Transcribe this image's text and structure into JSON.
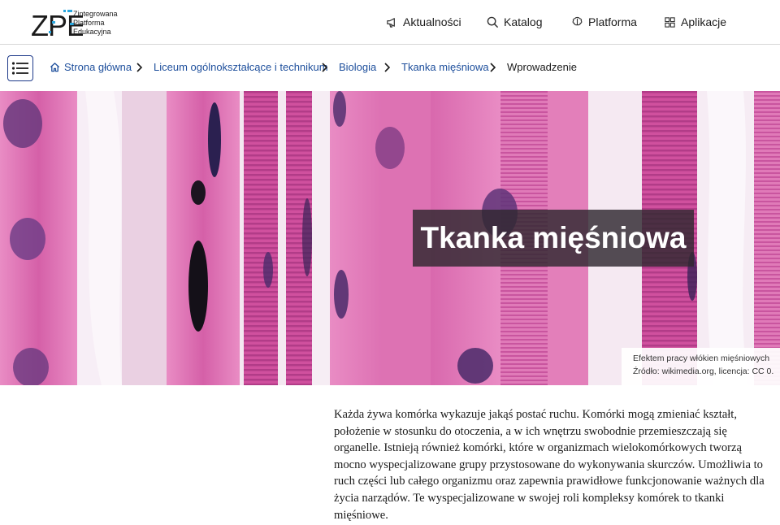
{
  "logo": {
    "mark": "ZPE",
    "line1": "Zintegrowana",
    "line2": "Platforma",
    "line3": "Edukacyjna"
  },
  "nav": [
    {
      "label": "Aktualności",
      "icon": "megaphone-icon"
    },
    {
      "label": "Katalog",
      "icon": "search-icon"
    },
    {
      "label": "Platforma",
      "icon": "brain-icon"
    },
    {
      "label": "Aplikacje",
      "icon": "grid-icon"
    }
  ],
  "breadcrumb": {
    "home": "Strona główna",
    "level1": "Liceum ogólnokształcące i technikum",
    "level2": "Biologia",
    "level3": "Tkanka mięśniowa",
    "current": "Wprowadzenie"
  },
  "hero": {
    "title": "Tkanka mięśniowa",
    "caption_line1": "Efektem pracy włókien mięśniowych",
    "caption_line2": "Źródło: wikimedia.org, licencja: CC 0."
  },
  "content": {
    "paragraph": "Każda żywa komórka wykazuje jakąś postać ruchu. Komórki mogą zmieniać kształt, położenie w stosunku do otoczenia, a w ich wnętrzu swobodnie przemieszczają się organelle. Istnieją również komórki, które w organizmach wielokomórkowych tworzą mocno wyspecjalizowane grupy przystosowane do wykonywania skurczów. Umożliwia to ruch części lub całego organizmu oraz zapewnia prawidłowe funkcjonowanie ważnych dla życia narządów. Te wyspecjalizowane w swojej roli kompleksy komórek to tkanki mięśniowe."
  },
  "colors": {
    "link": "#1e4f9c",
    "accent_blue": "#1e3a8a",
    "tissue_pink": "#d45aa6",
    "nucleus": "#4a2a6a"
  }
}
